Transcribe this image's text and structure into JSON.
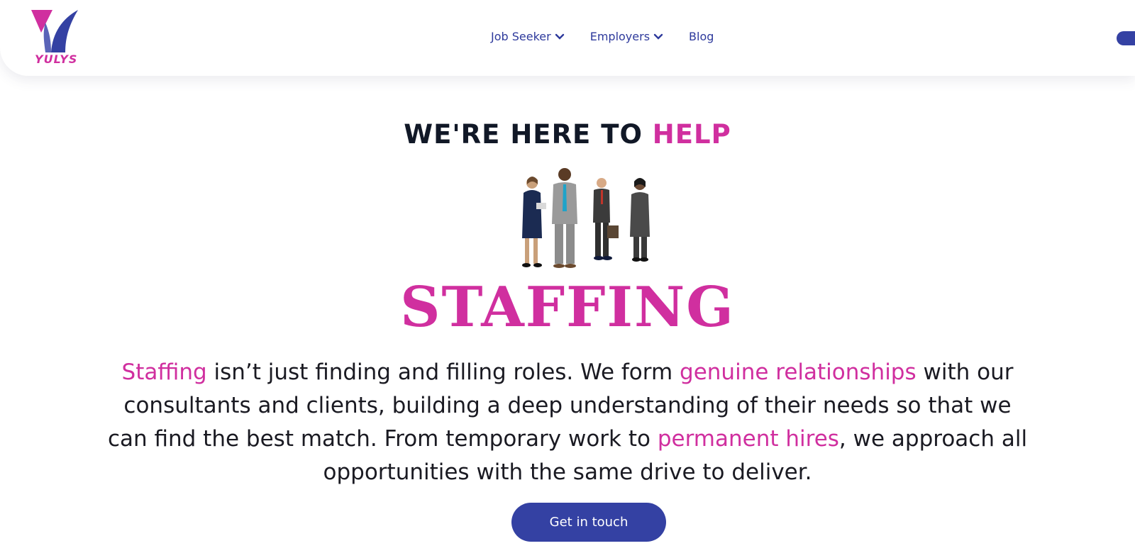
{
  "brand": {
    "name": "YULYS",
    "pink": "#d02f9f",
    "blue": "#3441a3"
  },
  "nav": {
    "items": [
      {
        "label": "Job Seeker",
        "dropdown": true
      },
      {
        "label": "Employers",
        "dropdown": true
      },
      {
        "label": "Blog",
        "dropdown": false
      }
    ]
  },
  "hero": {
    "title_prefix": "WE'RE HERE TO ",
    "title_accent": "HELP",
    "illustration": "business-people-group",
    "big_word": "STAFFING",
    "paragraph": [
      {
        "text": "Staffing",
        "highlight": true
      },
      {
        "text": " isn’t just finding and filling roles. We form ",
        "highlight": false
      },
      {
        "text": "genuine relationships",
        "highlight": true
      },
      {
        "text": " with our consultants and clients, building a deep understanding of their needs so that we can find the best match. From temporary work to ",
        "highlight": false
      },
      {
        "text": "permanent hires",
        "highlight": true
      },
      {
        "text": ", we approach all opportunities with the same drive to deliver.",
        "highlight": false
      }
    ],
    "cta_label": "Get in touch"
  }
}
